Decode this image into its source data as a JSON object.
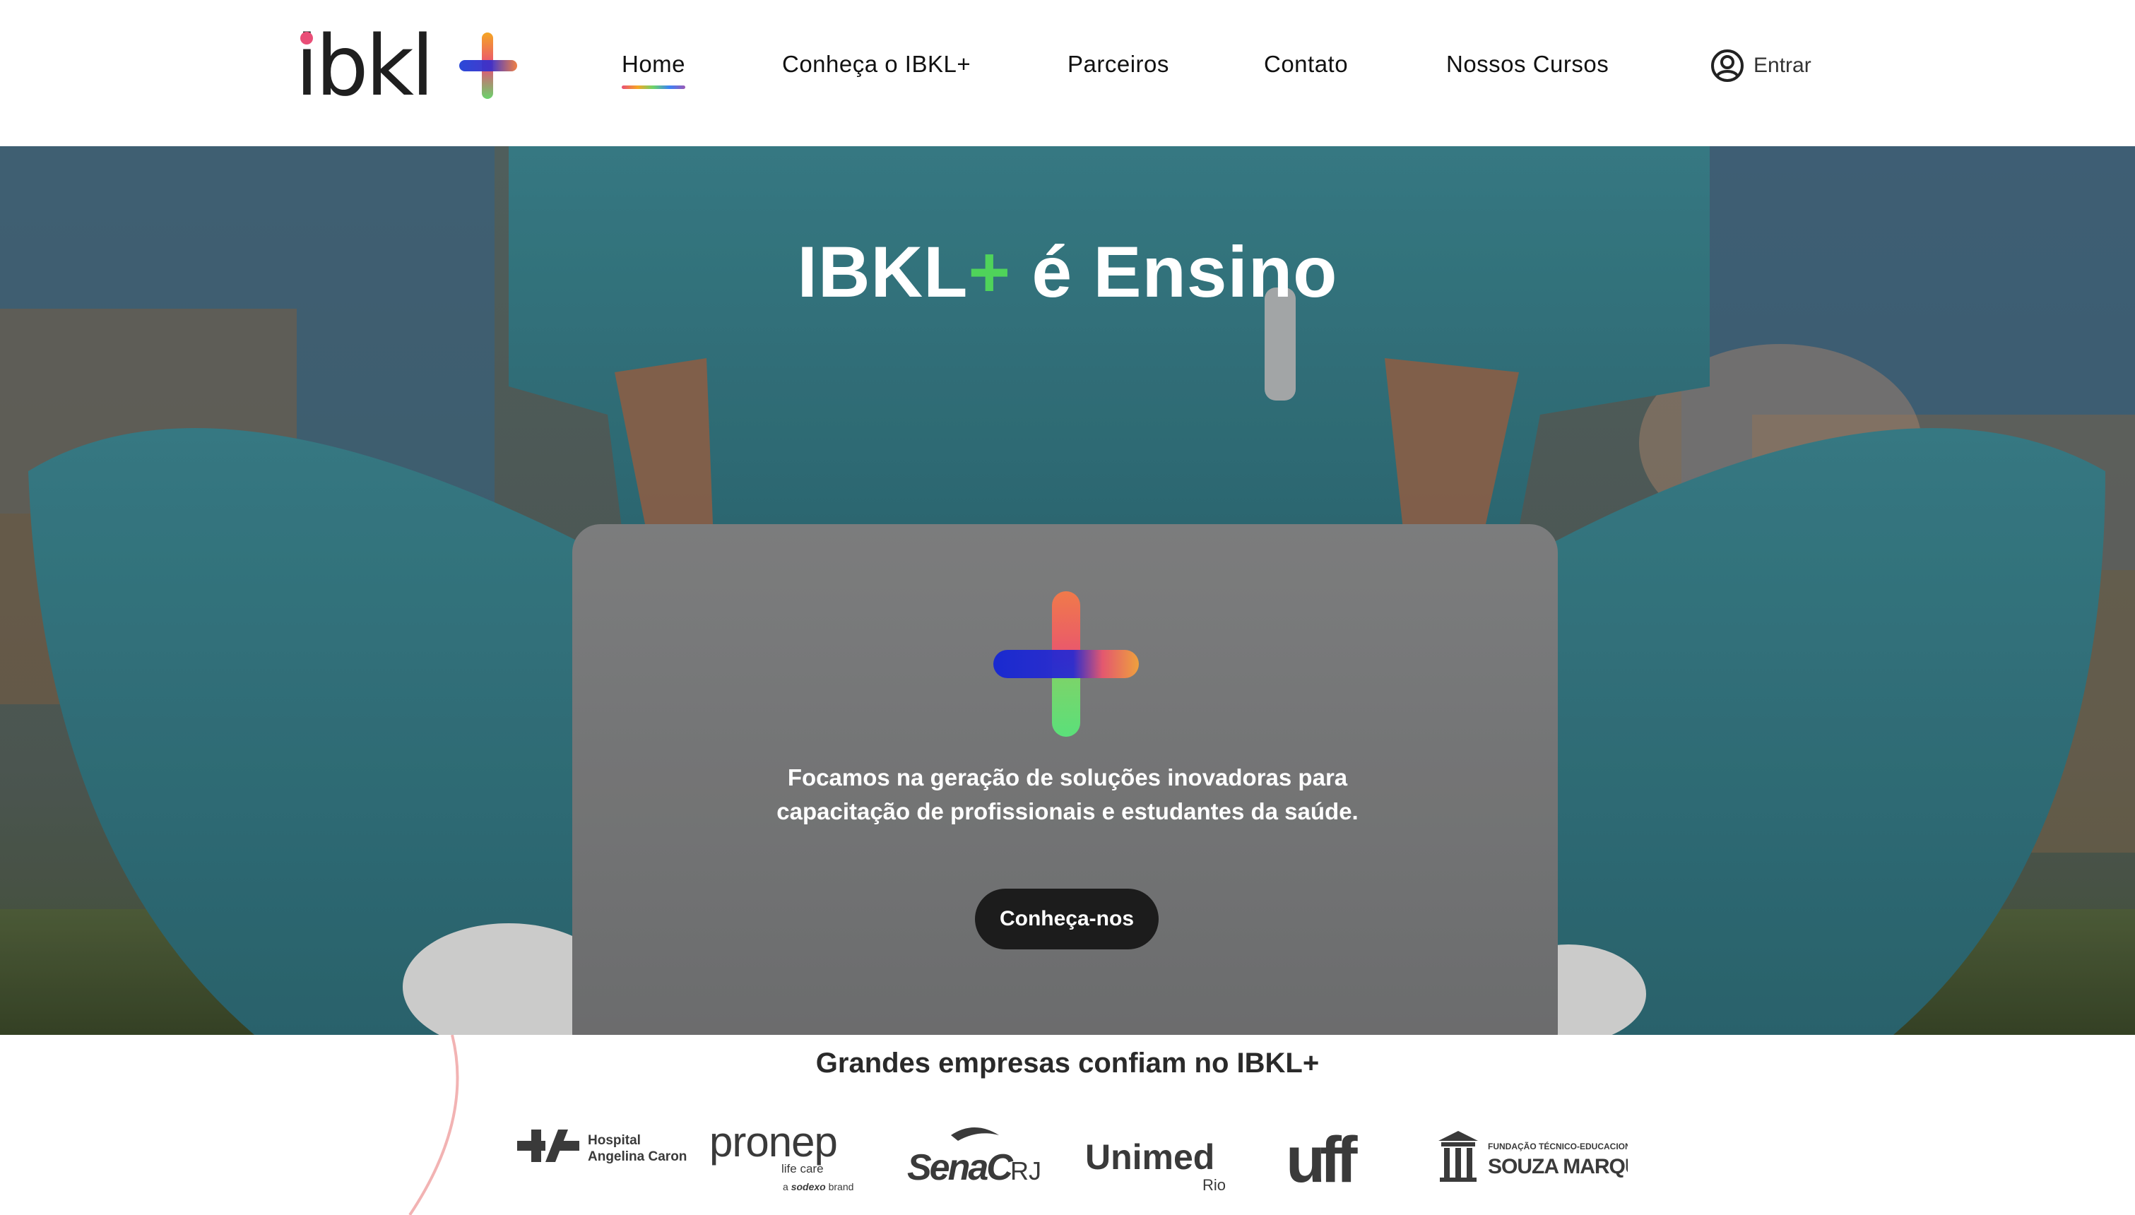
{
  "header": {
    "logo_text": "ibkl+",
    "nav": [
      {
        "label": "Home",
        "active": true
      },
      {
        "label": "Conheça o IBKL+"
      },
      {
        "label": "Parceiros"
      },
      {
        "label": "Contato"
      },
      {
        "label": "Nossos Cursos"
      }
    ],
    "login_label": "Entrar",
    "icons": {
      "login": "user-circle-icon"
    }
  },
  "hero": {
    "title_main": "IBKL",
    "title_plus": "+",
    "title_rest": " é Ensino",
    "description": "Focamos na geração de soluções inovadoras para capacitação de profissionais e estudantes da saúde.",
    "cta_label": "Conheça-nos"
  },
  "partners": {
    "title": "Grandes empresas confiam no IBKL+",
    "logos": [
      {
        "name": "Hospital Angelina Caron",
        "line1": "Hospital",
        "line2": "Angelina Caron"
      },
      {
        "name": "pronep",
        "word": "pronep",
        "sub": "life care",
        "tag_prefix": "a ",
        "tag_brand": "sodexo",
        "tag_suffix": " brand"
      },
      {
        "name": "Senac RJ",
        "word": "SenaC",
        "suffix": "RJ"
      },
      {
        "name": "Unimed Rio",
        "word": "Unimed",
        "sub": "Rio"
      },
      {
        "name": "uff",
        "word": "uff"
      },
      {
        "name": "Fundação Técnico-Educacional Souza Marques",
        "line1": "FUNDAÇÃO TÉCNICO-EDUCACIONAL",
        "line2": "SOUZA MARQUES"
      }
    ]
  },
  "colors": {
    "accent_green": "#4fd35a",
    "cta_bg": "#1c1c1c",
    "scrubs": "#3f8f98"
  }
}
